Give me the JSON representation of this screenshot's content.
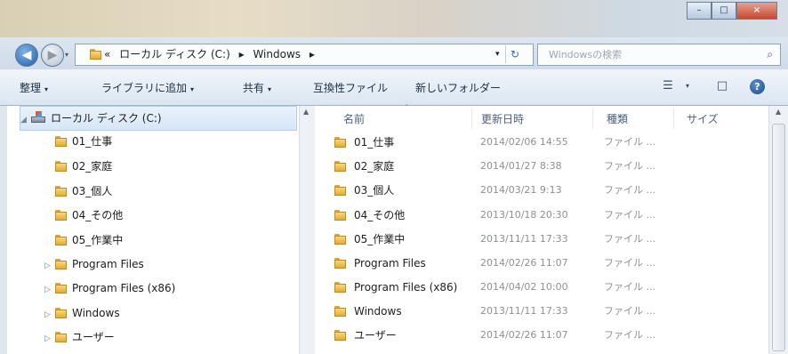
{
  "window": {
    "buttons": {
      "minimize": "–",
      "maximize": "□",
      "close": "×"
    }
  },
  "nav": {
    "back_glyph": "◀",
    "forward_glyph": "▶",
    "breadcrumb": [
      "«",
      "ローカル ディスク (C:)",
      "▸",
      "Windows",
      "▸"
    ],
    "refresh_glyph": "↻",
    "search_placeholder": "Windowsの検索",
    "search_glyph": "⌕"
  },
  "toolbar": {
    "organize": "整理",
    "include_library": "ライブラリに追加",
    "share": "共有",
    "compat_files": "互換性ファイル",
    "new_folder": "新しいフォルダー",
    "caret": "▾",
    "icons": [
      "view-options-icon",
      "preview-pane-icon",
      "help-icon"
    ],
    "help_glyph": "?",
    "preview_glyph": "□",
    "view_glyph": "☰"
  },
  "tree": {
    "drive": "ローカル ディスク (C:)",
    "children": [
      "01_仕事",
      "02_家庭",
      "03_個人",
      "04_その他",
      "05_作業中",
      "Program Files",
      "Program Files (x86)",
      "Windows",
      "ユーザー"
    ],
    "expander_open": "◢",
    "expander_closed": "▷"
  },
  "files": {
    "columns": {
      "name": "名前",
      "date": "更新日時",
      "type": "種類",
      "size": "サイズ"
    },
    "rows": [
      {
        "name": "01_仕事",
        "date": "2014/02/06 14:55",
        "type": "ファイル ..."
      },
      {
        "name": "02_家庭",
        "date": "2014/01/27 8:38",
        "type": "ファイル ..."
      },
      {
        "name": "03_個人",
        "date": "2014/03/21 9:13",
        "type": "ファイル ..."
      },
      {
        "name": "04_その他",
        "date": "2013/10/18 20:30",
        "type": "ファイル ..."
      },
      {
        "name": "05_作業中",
        "date": "2013/11/11 17:33",
        "type": "ファイル ..."
      },
      {
        "name": "Program Files",
        "date": "2014/02/26 11:07",
        "type": "ファイル ..."
      },
      {
        "name": "Program Files (x86)",
        "date": "2014/04/02 10:00",
        "type": "ファイル ..."
      },
      {
        "name": "Windows",
        "date": "2013/11/11 17:33",
        "type": "ファイル ..."
      },
      {
        "name": "ユーザー",
        "date": "2014/02/26 11:07",
        "type": "ファイル ..."
      }
    ],
    "extra_date": "2014/04/02 10:00",
    "extra_type": "ファイル ..."
  },
  "scroll": {
    "up": "▲"
  }
}
